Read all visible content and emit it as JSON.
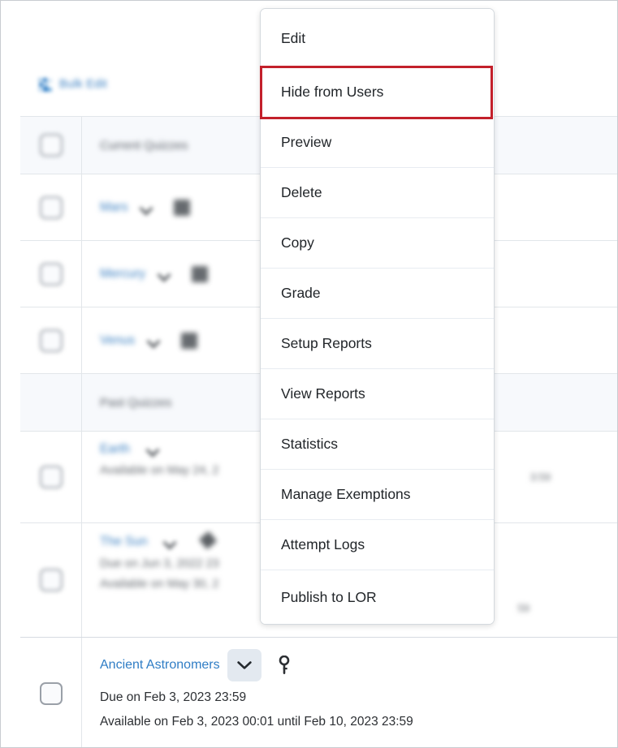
{
  "toolbar": {
    "bulk_edit_label": "Bulk Edit",
    "bulk_edit_icon": "bulk-edit-icon"
  },
  "context_menu": {
    "highlighted_item": "Hide from Users",
    "highlight_color": "#c3202b",
    "items": [
      {
        "label": "Edit"
      },
      {
        "label": "Hide from Users"
      },
      {
        "label": "Preview"
      },
      {
        "label": "Delete"
      },
      {
        "label": "Copy"
      },
      {
        "label": "Grade"
      },
      {
        "label": "Setup Reports"
      },
      {
        "label": "View Reports"
      },
      {
        "label": "Statistics"
      },
      {
        "label": "Manage Exemptions"
      },
      {
        "label": "Attempt Logs"
      },
      {
        "label": "Publish to LOR"
      }
    ]
  },
  "list": {
    "rows": [
      {
        "type": "section",
        "obscured": true,
        "label": "Current Quizzes"
      },
      {
        "type": "quiz",
        "obscured": true,
        "title": "Mars",
        "icons": [
          "chevron-down-icon",
          "status-icon"
        ]
      },
      {
        "type": "quiz",
        "obscured": true,
        "title": "Mercury",
        "icons": [
          "chevron-down-icon",
          "status-icon"
        ]
      },
      {
        "type": "quiz",
        "obscured": true,
        "title": "Venus",
        "icons": [
          "chevron-down-icon",
          "status-icon"
        ]
      },
      {
        "type": "section",
        "obscured": true,
        "label": "Past Quizzes"
      },
      {
        "type": "quiz",
        "obscured": true,
        "title": "Earth",
        "icons": [
          "chevron-down-icon"
        ],
        "meta": [
          "Available on May 24, 2"
        ],
        "right_text": "3:59"
      },
      {
        "type": "quiz",
        "obscured": true,
        "title": "The Sun",
        "icons": [
          "chevron-down-icon",
          "key-icon"
        ],
        "meta": [
          "Due on Jun 3, 2022 23",
          "Available on May 30, 2"
        ],
        "right_text": "59"
      },
      {
        "type": "quiz",
        "obscured": false,
        "title": "Ancient Astronomers",
        "icons": [
          "chevron-down-icon",
          "key-icon"
        ],
        "meta": [
          "Due on Feb 3, 2023 23:59",
          "Available on Feb 3, 2023 00:01 until Feb 10, 2023 23:59"
        ]
      }
    ]
  },
  "colors": {
    "link": "#2f7dc5",
    "text": "#212529",
    "border": "#e2e6ea",
    "section_bg": "#f7f9fc",
    "chevron_button_bg": "#e3e9f0"
  }
}
